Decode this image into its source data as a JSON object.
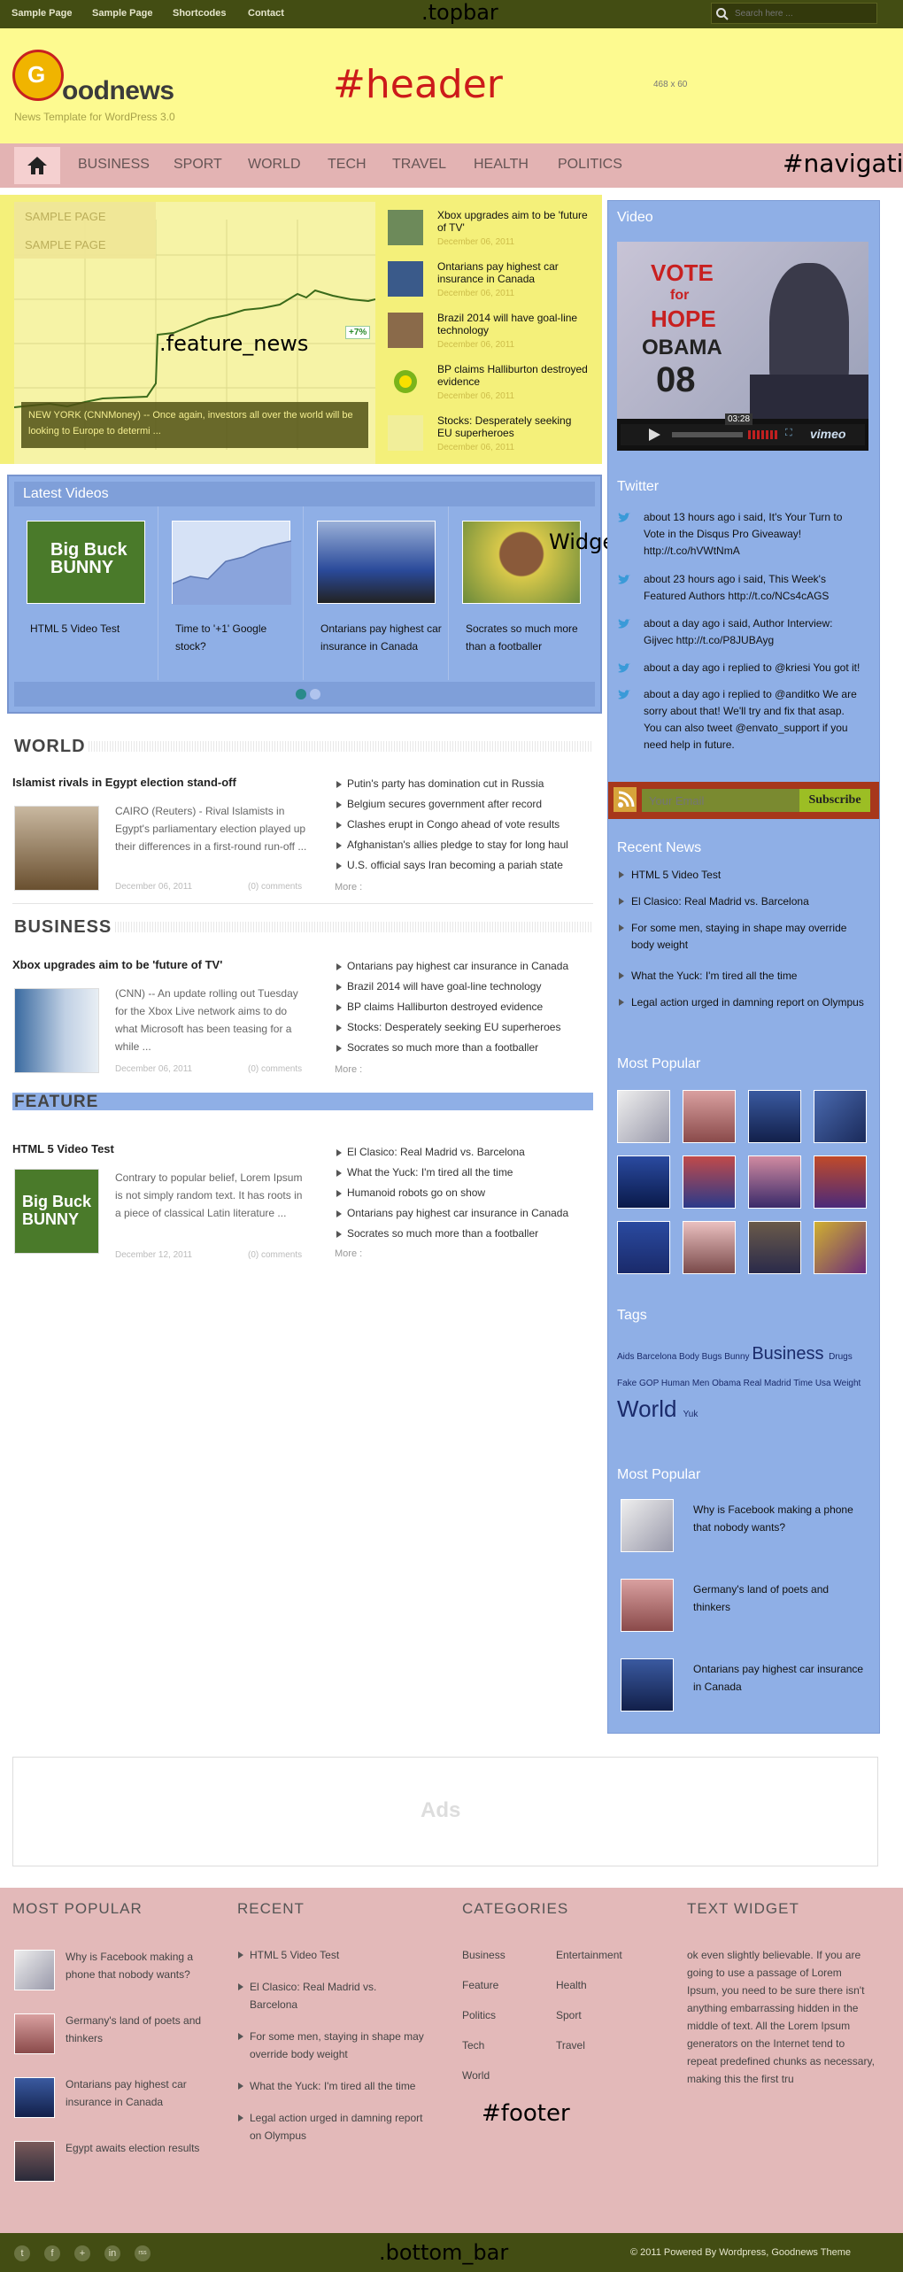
{
  "labels": {
    "topbar": ".topbar",
    "header": "#header",
    "navigation": "#navigation",
    "feature_news": ".feature_news",
    "widget": "Widget",
    "footer": "#footer",
    "bottom_bar": ".bottom_bar"
  },
  "topbar": {
    "links": [
      "Sample Page",
      "Sample Page",
      "Shortcodes",
      "Contact"
    ],
    "search_placeholder": "Search here ..."
  },
  "header": {
    "logo_text": "oodnews",
    "logo_letter": "G",
    "tagline": "News Template for WordPress 3.0",
    "ad_size": "468 x 60"
  },
  "nav": {
    "items": [
      "BUSINESS",
      "SPORT",
      "WORLD",
      "TECH",
      "TRAVEL",
      "HEALTH",
      "POLITICS"
    ],
    "dropdown": [
      "SAMPLE PAGE",
      "SAMPLE PAGE"
    ]
  },
  "feature": {
    "chart_badge": "+7%",
    "caption": "NEW YORK (CNNMoney) -- Once again, investors all over the world will be looking to Europe to determi ...",
    "items": [
      {
        "title": "Xbox upgrades aim to be 'future of TV'",
        "date": "December 06, 2011"
      },
      {
        "title": "Ontarians pay highest car insurance in Canada",
        "date": "December 06, 2011"
      },
      {
        "title": "Brazil 2014 will have goal-line technology",
        "date": "December 06, 2011"
      },
      {
        "title": "BP claims Halliburton destroyed evidence",
        "date": "December 06, 2011"
      },
      {
        "title": "Stocks: Desperately seeking EU superheroes",
        "date": "December 06, 2011"
      }
    ]
  },
  "latest_videos": {
    "title": "Latest Videos",
    "items": [
      "HTML 5 Video Test",
      "Time to '+1' Google stock?",
      "Ontarians pay highest car insurance in Canada",
      "Socrates so much more than a footballer"
    ]
  },
  "sections": [
    {
      "heading": "WORLD",
      "title": "Islamist rivals in Egypt election stand-off",
      "body": "CAIRO (Reuters) - Rival Islamists in Egypt's parliamentary election played up their differences in a first-round run-off ...",
      "date": "December 06, 2011",
      "comments": "(0) comments",
      "list": [
        "Putin's party has domination cut in Russia",
        "Belgium secures government after record",
        "Clashes erupt in Congo ahead of vote results",
        "Afghanistan's allies pledge to stay for long haul",
        "U.S. official says Iran becoming a pariah state"
      ],
      "more": "More :"
    },
    {
      "heading": "BUSINESS",
      "title": "Xbox upgrades aim to be 'future of TV'",
      "body": "(CNN) -- An update rolling out Tuesday for the Xbox Live network aims to do what Microsoft has been teasing for a while ...",
      "date": "December 06, 2011",
      "comments": "(0) comments",
      "list": [
        "Ontarians pay highest car insurance in Canada",
        "Brazil 2014 will have goal-line technology",
        "BP claims Halliburton destroyed evidence",
        "Stocks: Desperately seeking EU superheroes",
        "Socrates so much more than a footballer"
      ],
      "more": "More :"
    },
    {
      "heading": "FEATURE",
      "title": "HTML 5 Video Test",
      "body": "Contrary to popular belief, Lorem Ipsum is not simply random text. It has roots in a piece of classical Latin literature ...",
      "date": "December 12, 2011",
      "comments": "(0) comments",
      "list": [
        "El Clasico: Real Madrid vs. Barcelona",
        "What the Yuck: I'm tired all the time",
        "Humanoid robots go on show",
        "Ontarians pay highest car insurance in Canada",
        "Socrates so much more than a footballer"
      ],
      "more": "More :"
    }
  ],
  "sidebar": {
    "video_title": "Video",
    "video_poster": {
      "line1": "VOTE",
      "line2": "for",
      "line3": "HOPE",
      "line4": "OBAMA",
      "line5": "08"
    },
    "video_time": "03:28",
    "video_brand": "vimeo",
    "twitter_title": "Twitter",
    "tweets": [
      "about 13 hours ago i said, It's Your Turn to Vote in the Disqus Pro Giveaway! http://t.co/hVWtNmA",
      "about 23 hours ago i said, This Week's Featured Authors http://t.co/NCs4cAGS",
      "about a day ago i said, Author Interview: Gijvec http://t.co/P8JUBAyg",
      "about a day ago i replied to @kriesi You got it!",
      "about a day ago i replied to @anditko We are sorry about that! We'll try and fix that asap. You can also tweet @envato_support if you need help in future."
    ],
    "subscribe_placeholder": "Your Email",
    "subscribe_button": "Subscribe",
    "recent_title": "Recent News",
    "recent": [
      "HTML 5 Video Test",
      "El Clasico: Real Madrid vs. Barcelona",
      "For some men, staying in shape may override body weight",
      "What the Yuck: I'm tired all the time",
      "Legal action urged in damning report on Olympus"
    ],
    "popular_title": "Most Popular",
    "tags_title": "Tags",
    "tags": [
      {
        "t": "Aids",
        "s": 10
      },
      {
        "t": "Barcelona",
        "s": 10
      },
      {
        "t": "Body",
        "s": 10
      },
      {
        "t": "Bugs Bunny",
        "s": 10
      },
      {
        "t": "Business",
        "s": 20
      },
      {
        "t": "Drugs",
        "s": 10
      },
      {
        "t": "Fake",
        "s": 10
      },
      {
        "t": "GOP",
        "s": 10
      },
      {
        "t": "Human",
        "s": 10
      },
      {
        "t": "Men",
        "s": 10
      },
      {
        "t": "Obama",
        "s": 10
      },
      {
        "t": "Real Madrid",
        "s": 10
      },
      {
        "t": "Time",
        "s": 10
      },
      {
        "t": "Usa",
        "s": 10
      },
      {
        "t": "Weight",
        "s": 10
      },
      {
        "t": "World",
        "s": 26
      },
      {
        "t": "Yuk",
        "s": 10
      }
    ],
    "popular2_title": "Most Popular",
    "popular2": [
      "Why is Facebook making a phone that nobody wants?",
      "Germany's land of poets and thinkers",
      "Ontarians pay highest car insurance in Canada"
    ]
  },
  "ads": {
    "label": "Ads"
  },
  "footer": {
    "popular_title": "MOST POPULAR",
    "popular": [
      "Why is Facebook making a phone that nobody wants?",
      "Germany's land of poets and thinkers",
      "Ontarians pay highest car insurance in Canada",
      "Egypt awaits election results"
    ],
    "recent_title": "RECENT",
    "recent": [
      "HTML 5 Video Test",
      "El Clasico: Real Madrid vs. Barcelona",
      "For some men, staying in shape may override body weight",
      "What the Yuck: I'm tired all the time",
      "Legal action urged in damning report on Olympus"
    ],
    "categories_title": "CATEGORIES",
    "categories": [
      "Business",
      "Entertainment",
      "Feature",
      "Health",
      "Politics",
      "Sport",
      "Tech",
      "Travel",
      "World"
    ],
    "text_title": "TEXT WIDGET",
    "text": "ok even slightly believable. If you are going to use a passage of Lorem Ipsum, you need to be sure there isn't anything embarrassing hidden in the middle of text. All the Lorem Ipsum generators on the Internet tend to repeat predefined chunks as necessary, making this the first tru"
  },
  "bottom": {
    "copyright": "© 2011 Powered By Wordpress, Goodnews Theme",
    "social": [
      "t",
      "f",
      "+",
      "in",
      "rss"
    ]
  },
  "colors": {
    "topbar": "#434d13",
    "header": "#fdfa90",
    "nav": "#e3b3b3",
    "feature": "#f4f07a",
    "widget": "#8fafe6",
    "footer": "#e3b9b9"
  }
}
